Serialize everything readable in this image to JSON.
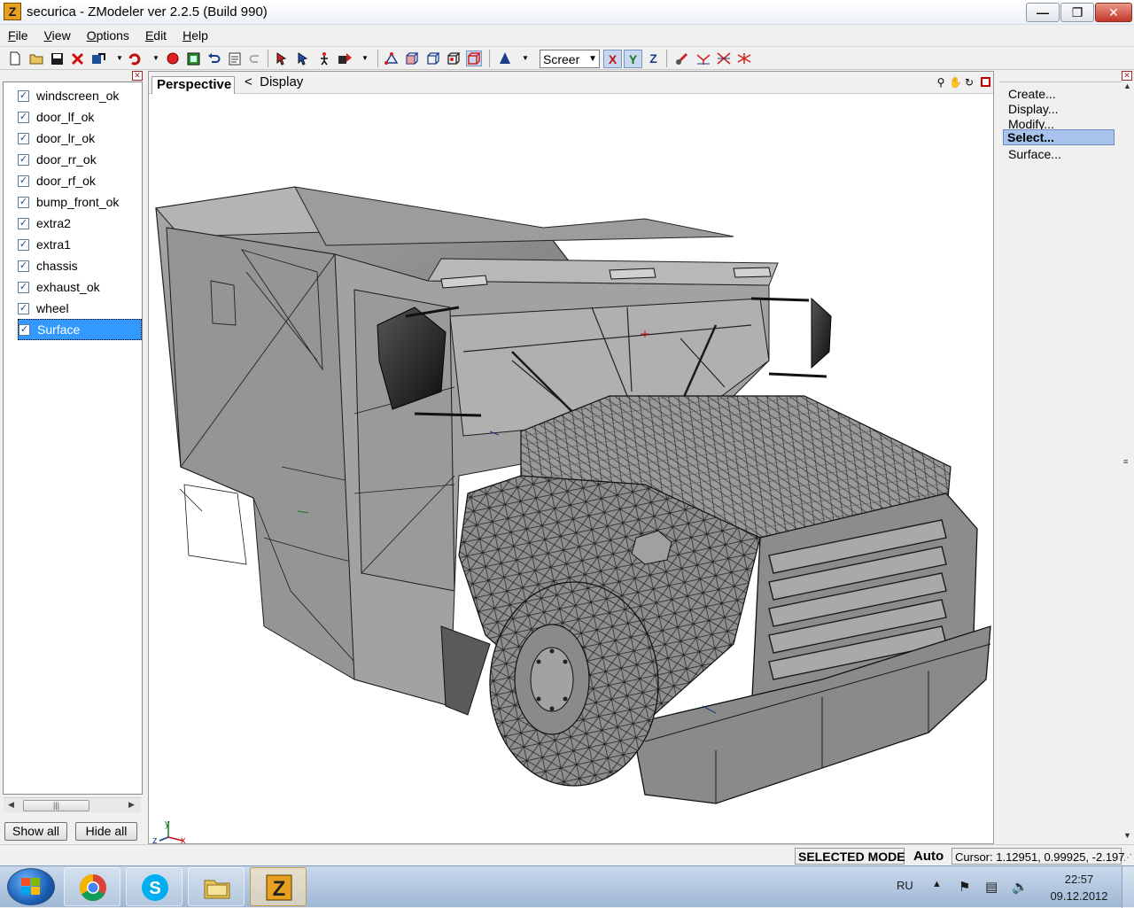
{
  "window": {
    "title": "securica - ZModeler ver 2.2.5 (Build 990)",
    "app_icon_letter": "Z"
  },
  "menu": [
    {
      "label": "File",
      "key": "F",
      "rest": "ile"
    },
    {
      "label": "View",
      "key": "V",
      "rest": "iew"
    },
    {
      "label": "Options",
      "key": "O",
      "rest": "ptions"
    },
    {
      "label": "Edit",
      "key": "E",
      "rest": "dit"
    },
    {
      "label": "Help",
      "key": "H",
      "rest": "elp"
    }
  ],
  "toolbar": {
    "coord_mode": "Screer",
    "axes": {
      "x": "X",
      "y": "Y",
      "z": "Z"
    }
  },
  "objects": [
    {
      "label": "windscreen_ok",
      "checked": true
    },
    {
      "label": "door_lf_ok",
      "checked": true
    },
    {
      "label": "door_lr_ok",
      "checked": true
    },
    {
      "label": "door_rr_ok",
      "checked": true
    },
    {
      "label": "door_rf_ok",
      "checked": true
    },
    {
      "label": "bump_front_ok",
      "checked": true
    },
    {
      "label": "extra2",
      "checked": true
    },
    {
      "label": "extra1",
      "checked": true
    },
    {
      "label": "chassis",
      "checked": true
    },
    {
      "label": "exhaust_ok",
      "checked": true
    },
    {
      "label": "wheel",
      "checked": true
    },
    {
      "label": "Surface",
      "checked": true,
      "selected": true
    }
  ],
  "object_buttons": {
    "show_all": "Show all",
    "hide_all": "Hide all"
  },
  "viewport": {
    "tab": "Perspective",
    "display_back": "<",
    "display_label": "Display",
    "axis_labels": {
      "y": "y",
      "z": "z",
      "x": "x"
    }
  },
  "command_panel": {
    "items": [
      "Create...",
      "Display...",
      "Modify...",
      "Select...",
      "Surface..."
    ],
    "selected": "Select..."
  },
  "status": {
    "mode": "SELECTED MODE",
    "snap": "Auto",
    "cursor": "Cursor: 1.12951, 0.99925, -2.197"
  },
  "taskbar": {
    "language": "RU",
    "time": "22:57",
    "date": "09.12.2012",
    "apps": [
      "chrome-icon",
      "skype-icon",
      "explorer-icon",
      "zmodeler-icon"
    ]
  },
  "colors": {
    "selection": "#3399ff",
    "command_selected": "#a8c4ec",
    "mesh_fill": "#8e8e8e",
    "mesh_lines": "#1e1e1e"
  }
}
